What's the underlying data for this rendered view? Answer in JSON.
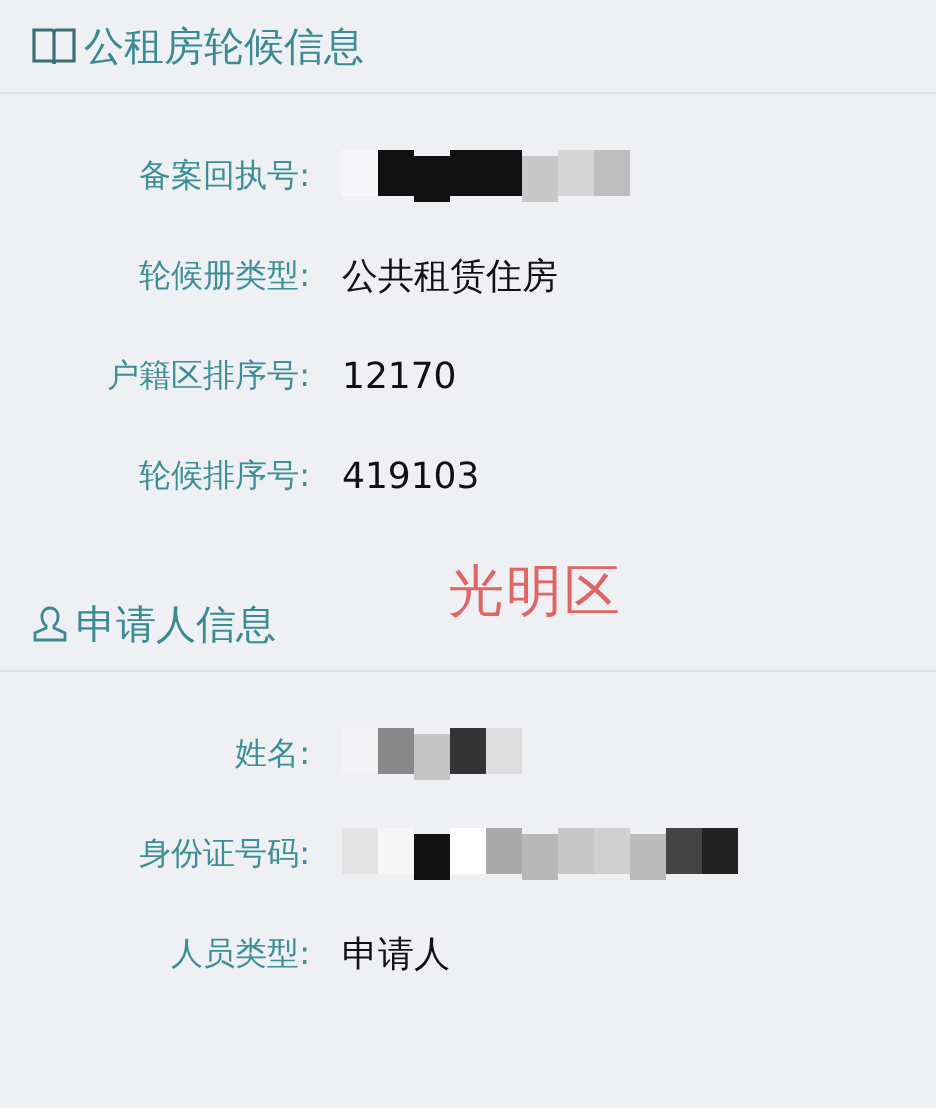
{
  "sections": [
    {
      "title": "公租房轮候信息",
      "rows": [
        {
          "label": "备案回执号:",
          "kind": "redacted"
        },
        {
          "label": "轮候册类型:",
          "kind": "text",
          "value": "公共租赁住房"
        },
        {
          "label": "户籍区排序号:",
          "kind": "text",
          "value": "12170"
        },
        {
          "label": "轮候排序号:",
          "kind": "text",
          "value": "419103"
        }
      ]
    },
    {
      "title": "申请人信息",
      "rows": [
        {
          "label": "姓名:",
          "kind": "redacted"
        },
        {
          "label": "身份证号码:",
          "kind": "redacted"
        },
        {
          "label": "人员类型:",
          "kind": "text",
          "value": "申请人"
        }
      ]
    }
  ],
  "annotation": "光明区"
}
